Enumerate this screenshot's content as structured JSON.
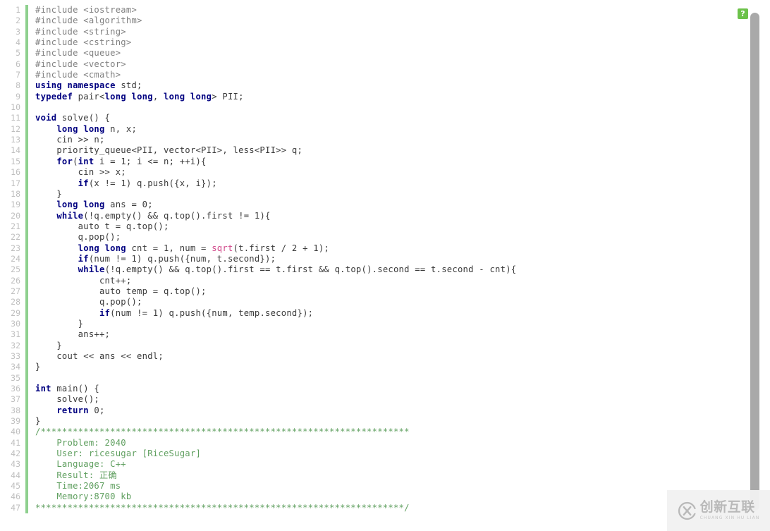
{
  "editor": {
    "language": "C++",
    "total_lines": 47,
    "gutter_accent_color": "#8ed08e",
    "background_color": "#ffffff",
    "colors": {
      "keyword": "#000080",
      "preprocessor": "#808080",
      "builtin_function": "#d1488a",
      "comment": "#5f9f5f",
      "plain": "#3a3a3a",
      "line_number": "#bfbfbf"
    }
  },
  "badge": {
    "name": "code-status-badge",
    "label": "?",
    "color": "#6cc24a"
  },
  "scrollbar": {
    "name": "vertical-scrollbar",
    "thumb_color": "#a9a9a9",
    "position_percent": 0
  },
  "watermark": {
    "logo": "cx-circle-logo",
    "chinese": "创新互联",
    "pinyin": "CHUANG XIN HU LIAN"
  },
  "submission_info": {
    "problem": "2040",
    "user": "ricesugar [RiceSugar]",
    "language": "C++",
    "result": "正确",
    "time": "2067 ms",
    "memory": "8700 kb"
  },
  "code_lines": [
    {
      "n": 1,
      "tokens": [
        {
          "t": "pp",
          "s": "#include <iostream>"
        }
      ]
    },
    {
      "n": 2,
      "tokens": [
        {
          "t": "pp",
          "s": "#include <algorithm>"
        }
      ]
    },
    {
      "n": 3,
      "tokens": [
        {
          "t": "pp",
          "s": "#include <string>"
        }
      ]
    },
    {
      "n": 4,
      "tokens": [
        {
          "t": "pp",
          "s": "#include <cstring>"
        }
      ]
    },
    {
      "n": 5,
      "tokens": [
        {
          "t": "pp",
          "s": "#include <queue>"
        }
      ]
    },
    {
      "n": 6,
      "tokens": [
        {
          "t": "pp",
          "s": "#include <vector>"
        }
      ]
    },
    {
      "n": 7,
      "tokens": [
        {
          "t": "pp",
          "s": "#include <cmath>"
        }
      ]
    },
    {
      "n": 8,
      "tokens": [
        {
          "t": "k",
          "s": "using namespace"
        },
        {
          "t": "pl",
          "s": " std;"
        }
      ]
    },
    {
      "n": 9,
      "tokens": [
        {
          "t": "k",
          "s": "typedef"
        },
        {
          "t": "pl",
          "s": " pair<"
        },
        {
          "t": "k",
          "s": "long long"
        },
        {
          "t": "pl",
          "s": ", "
        },
        {
          "t": "k",
          "s": "long long"
        },
        {
          "t": "pl",
          "s": "> PII;"
        }
      ]
    },
    {
      "n": 10,
      "tokens": [
        {
          "t": "pl",
          "s": ""
        }
      ]
    },
    {
      "n": 11,
      "tokens": [
        {
          "t": "k",
          "s": "void"
        },
        {
          "t": "pl",
          "s": " solve() {"
        }
      ]
    },
    {
      "n": 12,
      "tokens": [
        {
          "t": "pl",
          "s": "    "
        },
        {
          "t": "k",
          "s": "long long"
        },
        {
          "t": "pl",
          "s": " n, x;"
        }
      ]
    },
    {
      "n": 13,
      "tokens": [
        {
          "t": "pl",
          "s": "    cin >> n;"
        }
      ]
    },
    {
      "n": 14,
      "tokens": [
        {
          "t": "pl",
          "s": "    priority_queue<PII, vector<PII>, less<PII>> q;"
        }
      ]
    },
    {
      "n": 15,
      "tokens": [
        {
          "t": "pl",
          "s": "    "
        },
        {
          "t": "k",
          "s": "for"
        },
        {
          "t": "pl",
          "s": "("
        },
        {
          "t": "k",
          "s": "int"
        },
        {
          "t": "pl",
          "s": " i = 1; i <= n; ++i){"
        }
      ]
    },
    {
      "n": 16,
      "tokens": [
        {
          "t": "pl",
          "s": "        cin >> x;"
        }
      ]
    },
    {
      "n": 17,
      "tokens": [
        {
          "t": "pl",
          "s": "        "
        },
        {
          "t": "k",
          "s": "if"
        },
        {
          "t": "pl",
          "s": "(x != 1) q.push({x, i});"
        }
      ]
    },
    {
      "n": 18,
      "tokens": [
        {
          "t": "pl",
          "s": "    }"
        }
      ]
    },
    {
      "n": 19,
      "tokens": [
        {
          "t": "pl",
          "s": "    "
        },
        {
          "t": "k",
          "s": "long long"
        },
        {
          "t": "pl",
          "s": " ans = 0;"
        }
      ]
    },
    {
      "n": 20,
      "tokens": [
        {
          "t": "pl",
          "s": "    "
        },
        {
          "t": "k",
          "s": "while"
        },
        {
          "t": "pl",
          "s": "(!q.empty() && q.top().first != 1){"
        }
      ]
    },
    {
      "n": 21,
      "tokens": [
        {
          "t": "pl",
          "s": "        auto t = q.top();"
        }
      ]
    },
    {
      "n": 22,
      "tokens": [
        {
          "t": "pl",
          "s": "        q.pop();"
        }
      ]
    },
    {
      "n": 23,
      "tokens": [
        {
          "t": "pl",
          "s": "        "
        },
        {
          "t": "k",
          "s": "long long"
        },
        {
          "t": "pl",
          "s": " cnt = 1, num = "
        },
        {
          "t": "fn",
          "s": "sqrt"
        },
        {
          "t": "pl",
          "s": "(t.first / 2 + 1);"
        }
      ]
    },
    {
      "n": 24,
      "tokens": [
        {
          "t": "pl",
          "s": "        "
        },
        {
          "t": "k",
          "s": "if"
        },
        {
          "t": "pl",
          "s": "(num != 1) q.push({num, t.second});"
        }
      ]
    },
    {
      "n": 25,
      "tokens": [
        {
          "t": "pl",
          "s": "        "
        },
        {
          "t": "k",
          "s": "while"
        },
        {
          "t": "pl",
          "s": "(!q.empty() && q.top().first == t.first && q.top().second == t.second - cnt){"
        }
      ]
    },
    {
      "n": 26,
      "tokens": [
        {
          "t": "pl",
          "s": "            cnt++;"
        }
      ]
    },
    {
      "n": 27,
      "tokens": [
        {
          "t": "pl",
          "s": "            auto temp = q.top();"
        }
      ]
    },
    {
      "n": 28,
      "tokens": [
        {
          "t": "pl",
          "s": "            q.pop();"
        }
      ]
    },
    {
      "n": 29,
      "tokens": [
        {
          "t": "pl",
          "s": "            "
        },
        {
          "t": "k",
          "s": "if"
        },
        {
          "t": "pl",
          "s": "(num != 1) q.push({num, temp.second});"
        }
      ]
    },
    {
      "n": 30,
      "tokens": [
        {
          "t": "pl",
          "s": "        }"
        }
      ]
    },
    {
      "n": 31,
      "tokens": [
        {
          "t": "pl",
          "s": "        ans++;"
        }
      ]
    },
    {
      "n": 32,
      "tokens": [
        {
          "t": "pl",
          "s": "    }"
        }
      ]
    },
    {
      "n": 33,
      "tokens": [
        {
          "t": "pl",
          "s": "    cout << ans << endl;"
        }
      ]
    },
    {
      "n": 34,
      "tokens": [
        {
          "t": "pl",
          "s": "}"
        }
      ]
    },
    {
      "n": 35,
      "tokens": [
        {
          "t": "pl",
          "s": ""
        }
      ]
    },
    {
      "n": 36,
      "tokens": [
        {
          "t": "k",
          "s": "int"
        },
        {
          "t": "pl",
          "s": " main() {"
        }
      ]
    },
    {
      "n": 37,
      "tokens": [
        {
          "t": "pl",
          "s": "    solve();"
        }
      ]
    },
    {
      "n": 38,
      "tokens": [
        {
          "t": "pl",
          "s": "    "
        },
        {
          "t": "k",
          "s": "return"
        },
        {
          "t": "pl",
          "s": " 0;"
        }
      ]
    },
    {
      "n": 39,
      "tokens": [
        {
          "t": "pl",
          "s": "}"
        }
      ]
    },
    {
      "n": 40,
      "tokens": [
        {
          "t": "cm",
          "s": "/*********************************************************************"
        }
      ]
    },
    {
      "n": 41,
      "tokens": [
        {
          "t": "cm",
          "s": "    Problem: 2040"
        }
      ]
    },
    {
      "n": 42,
      "tokens": [
        {
          "t": "cm",
          "s": "    User: ricesugar [RiceSugar]"
        }
      ]
    },
    {
      "n": 43,
      "tokens": [
        {
          "t": "cm",
          "s": "    Language: C++"
        }
      ]
    },
    {
      "n": 44,
      "tokens": [
        {
          "t": "cm",
          "s": "    Result: 正确"
        }
      ]
    },
    {
      "n": 45,
      "tokens": [
        {
          "t": "cm",
          "s": "    Time:2067 ms"
        }
      ]
    },
    {
      "n": 46,
      "tokens": [
        {
          "t": "cm",
          "s": "    Memory:8700 kb"
        }
      ]
    },
    {
      "n": 47,
      "tokens": [
        {
          "t": "cm",
          "s": "*********************************************************************/"
        }
      ]
    }
  ]
}
